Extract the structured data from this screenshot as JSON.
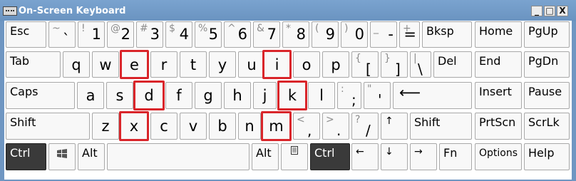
{
  "window": {
    "title": "On-Screen Keyboard",
    "minimize": "_",
    "maximize": "□",
    "close": "X"
  },
  "keys": {
    "esc": "Esc",
    "tilde": {
      "shift": "~",
      "base": "`"
    },
    "d1": {
      "shift": "!",
      "base": "1"
    },
    "d2": {
      "shift": "@",
      "base": "2"
    },
    "d3": {
      "shift": "#",
      "base": "3"
    },
    "d4": {
      "shift": "$",
      "base": "4"
    },
    "d5": {
      "shift": "%",
      "base": "5"
    },
    "d6": {
      "shift": "^",
      "base": "6"
    },
    "d7": {
      "shift": "&",
      "base": "7"
    },
    "d8": {
      "shift": "*",
      "base": "8"
    },
    "d9": {
      "shift": "(",
      "base": "9"
    },
    "d0": {
      "shift": ")",
      "base": "0"
    },
    "minus": {
      "shift": "_",
      "base": "-"
    },
    "equals": {
      "shift": "+",
      "base": "="
    },
    "bksp": "Bksp",
    "home": "Home",
    "pgup": "PgUp",
    "tab": "Tab",
    "q": "q",
    "w": "w",
    "e": "e",
    "r": "r",
    "t": "t",
    "y": "y",
    "u": "u",
    "i": "i",
    "o": "o",
    "p": "p",
    "lbracket": {
      "shift": "{",
      "base": "["
    },
    "rbracket": {
      "shift": "}",
      "base": "]"
    },
    "backslash": {
      "shift": "|",
      "base": "\\"
    },
    "del": "Del",
    "end": "End",
    "pgdn": "PgDn",
    "caps": "Caps",
    "a": "a",
    "s": "s",
    "d": "d",
    "f": "f",
    "g": "g",
    "h": "h",
    "j": "j",
    "k": "k",
    "l": "l",
    "semicolon": {
      "shift": ":",
      "base": ";"
    },
    "quote": {
      "shift": "\"",
      "base": "'"
    },
    "enter": "⟵",
    "insert": "Insert",
    "pause": "Pause",
    "lshift": "Shift",
    "z": "z",
    "x": "x",
    "c": "c",
    "v": "v",
    "b": "b",
    "n": "n",
    "m": "m",
    "comma": {
      "shift": "<",
      "base": ","
    },
    "period": {
      "shift": ">",
      "base": "."
    },
    "slash": {
      "shift": "?",
      "base": "/"
    },
    "up": "↑",
    "rshift": "Shift",
    "prtscn": "PrtScn",
    "scrlk": "ScrLk",
    "lctrl": "Ctrl",
    "win": "win-logo-icon",
    "lalt": "Alt",
    "ralt": "Alt",
    "menu": "menu-icon",
    "rctrl": "Ctrl",
    "left": "←",
    "down": "↓",
    "right": "→",
    "fn": "Fn",
    "options": "Options",
    "help": "Help"
  },
  "highlighted_keys": [
    "e",
    "i",
    "d",
    "k",
    "x",
    "m"
  ],
  "colors": {
    "highlight": "#d9252a",
    "titlebar": "#6f96c2",
    "pressed_key": "#3a3a3a"
  }
}
